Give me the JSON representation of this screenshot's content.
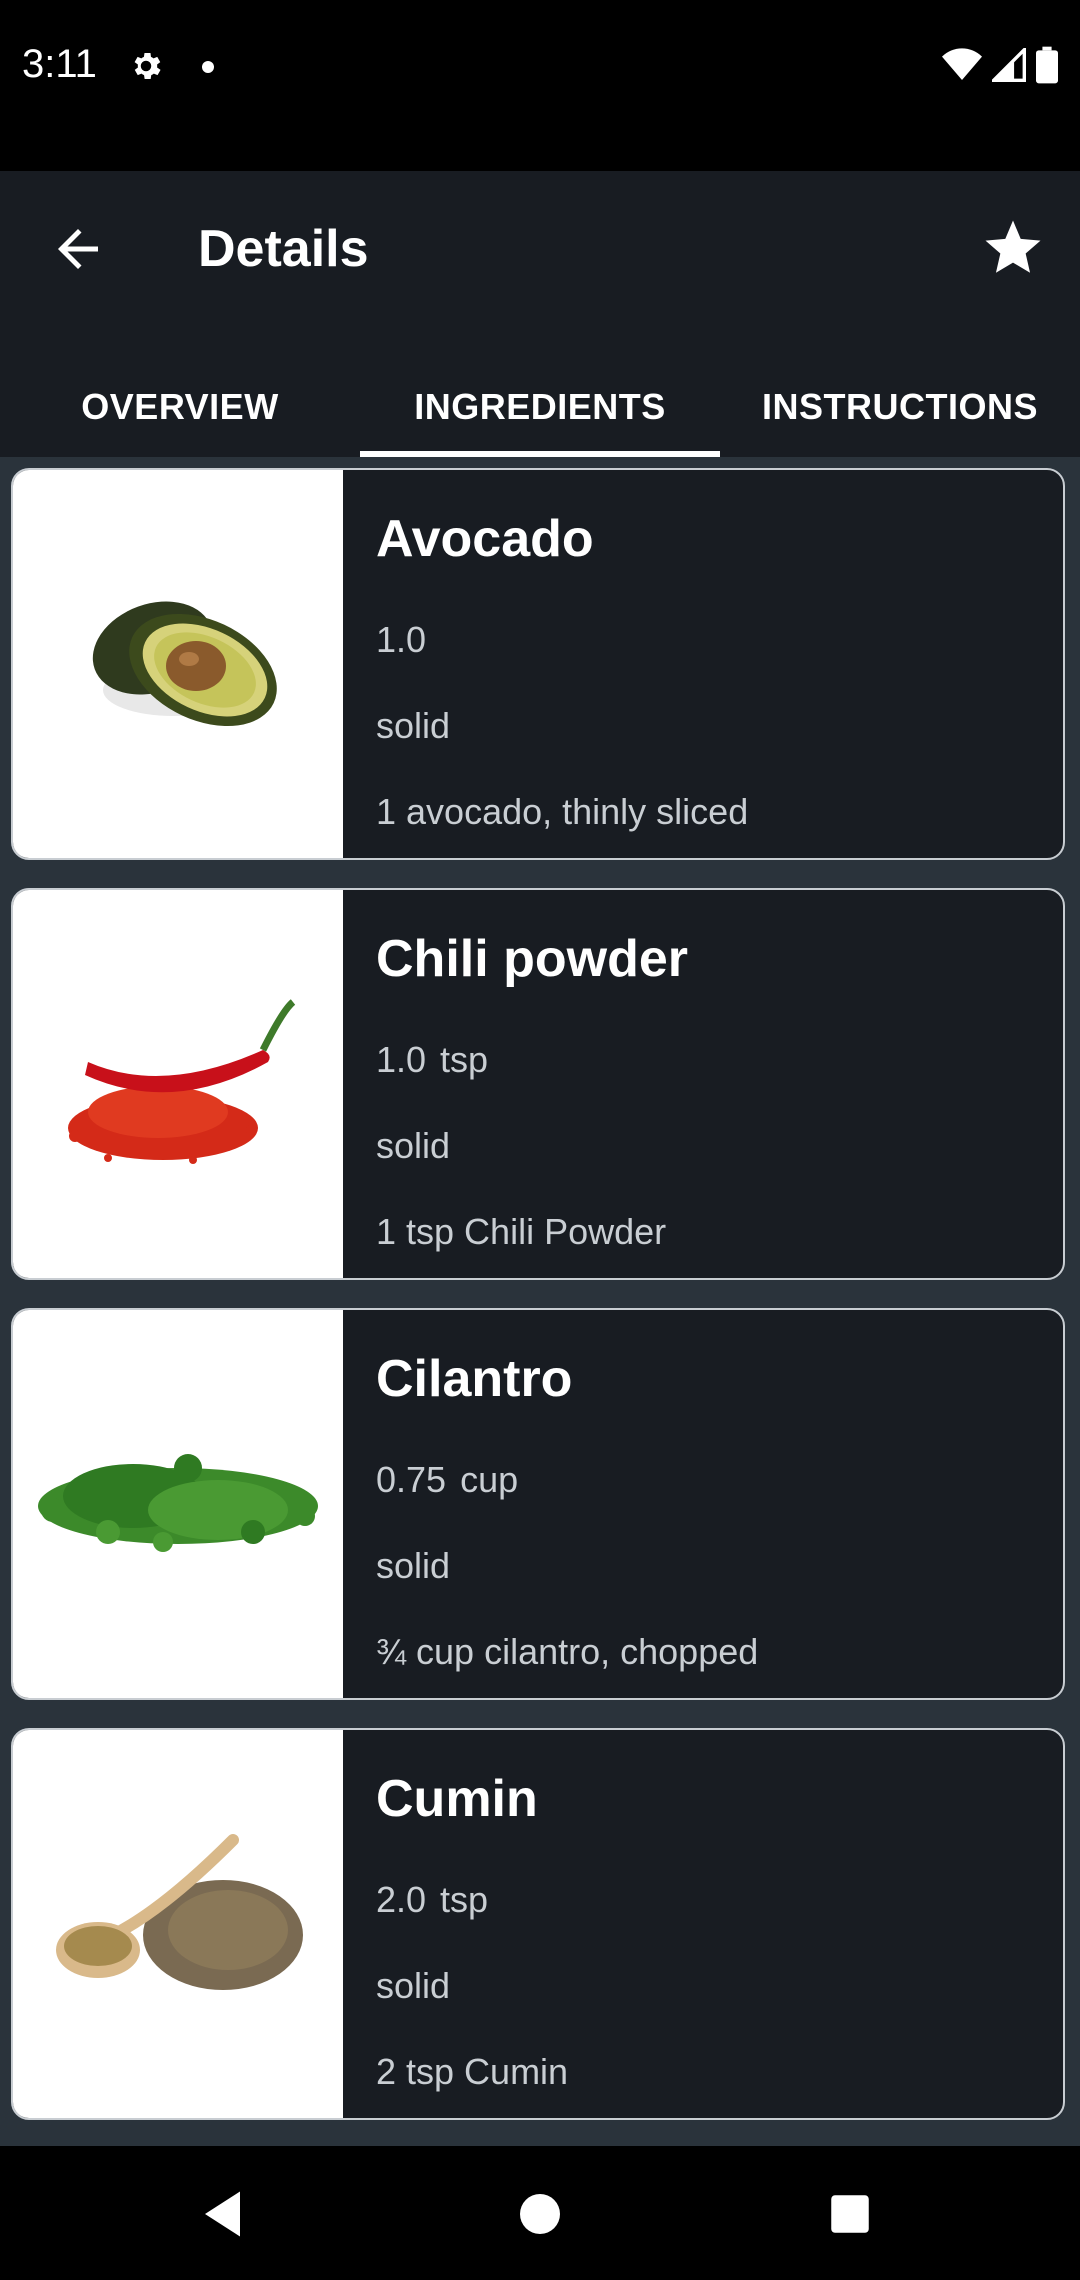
{
  "status_bar": {
    "time": "3:11",
    "icons": [
      "gear-icon",
      "notification-dot",
      "wifi-icon",
      "cell-signal-icon",
      "battery-icon"
    ]
  },
  "app_bar": {
    "title": "Details",
    "back_icon": "arrow-back-icon",
    "favorite_icon": "star-icon"
  },
  "tabs": [
    {
      "label": "OVERVIEW",
      "selected": false
    },
    {
      "label": "INGREDIENTS",
      "selected": true
    },
    {
      "label": "INSTRUCTIONS",
      "selected": false
    }
  ],
  "ingredients": [
    {
      "name": "Avocado",
      "amount": "1.0",
      "unit": "",
      "state": "solid",
      "original": "1 avocado, thinly sliced",
      "image": "avocado-image"
    },
    {
      "name": "Chili powder",
      "amount": "1.0",
      "unit": "tsp",
      "state": "solid",
      "original": "1 tsp Chili Powder",
      "image": "chili-powder-image"
    },
    {
      "name": "Cilantro",
      "amount": "0.75",
      "unit": "cup",
      "state": "solid",
      "original": "¾ cup cilantro, chopped",
      "image": "cilantro-image"
    },
    {
      "name": "Cumin",
      "amount": "2.0",
      "unit": "tsp",
      "state": "solid",
      "original": "2 tsp Cumin",
      "image": "cumin-image"
    }
  ],
  "nav_bar": {
    "back": "nav-back-icon",
    "home": "nav-home-icon",
    "recents": "nav-recents-icon"
  },
  "colors": {
    "app_bar": "#181c22",
    "background": "#2a333b",
    "card": "#181c22",
    "secondary_text": "#c9ced3"
  }
}
